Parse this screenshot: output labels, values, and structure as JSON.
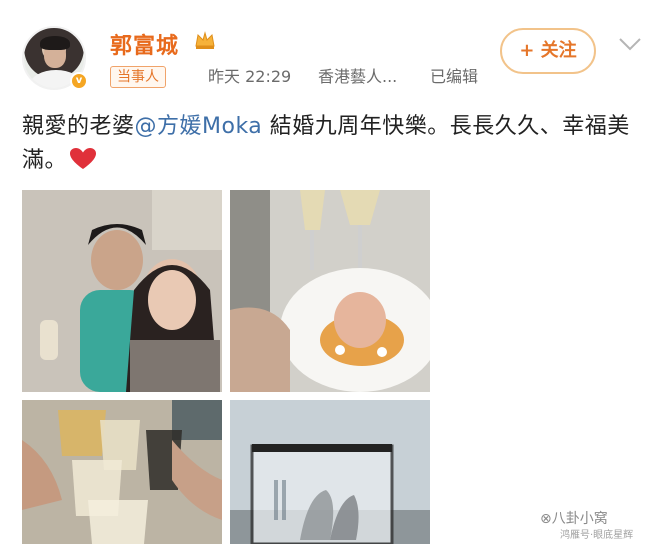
{
  "user": {
    "name": "郭富城",
    "badge_label": "当事人",
    "time": "昨天 22:29",
    "source": "香港藝人...",
    "edited": "已编辑"
  },
  "follow_button": {
    "label": "+ 关注"
  },
  "post": {
    "text_before": "親愛的老婆",
    "mention": "@方媛Moka",
    "text_after": " 結婚九周年快樂。長長久久、幸福美滿。"
  },
  "photos": [
    {
      "subject": "couple-selfie"
    },
    {
      "subject": "dessert-plate-with-glasses"
    },
    {
      "subject": "champagne-toast"
    },
    {
      "subject": "glass-plaque-outdoor"
    }
  ],
  "watermark": {
    "text": "⊗八卦小窝",
    "sub": "鸿雁号·眼底星辉"
  },
  "colors": {
    "username": "#e86a1c",
    "mention": "#3e6fa8",
    "follow": "#e5762a"
  }
}
